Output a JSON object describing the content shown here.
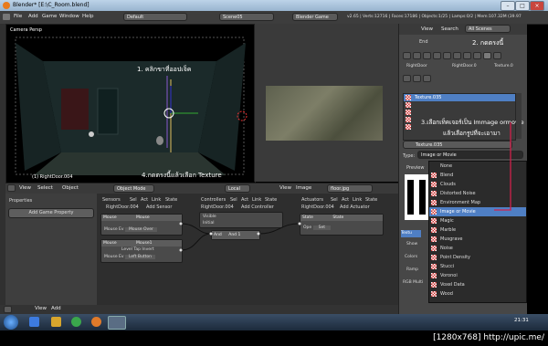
{
  "window": {
    "title": "Blender* [E:\\C_Room.blend]"
  },
  "menu": {
    "items": [
      "File",
      "Add",
      "Game",
      "Window",
      "Help"
    ],
    "layout": "Default",
    "scene": "Scene05",
    "engine": "Blender Game",
    "stats": "v2.65 | Verts:12716 | Faces:17186 | Objects:1/25 | Lamps:0/2 | Mem:107.32M (39.97"
  },
  "viewport": {
    "label": "Camera Persp",
    "object": "(1) RightDoor.004"
  },
  "annotations": {
    "a1": "1. คลิกขาที่ออปเจ็ค",
    "a2": "2. กดตรงนี้",
    "a3": "3.เลือกเท็คเจอร์เป็น Immage ormovie",
    "a3b": "แล้วเลือกรูปที่จะเอามา",
    "a4": "4.กดตรงนี้แล้วเลือก Texture"
  },
  "toolbar": {
    "items": [
      "View",
      "Select",
      "Object"
    ],
    "mode": "Object Mode",
    "orient": "Local",
    "view": "View",
    "image": "Image",
    "image_name": "floor.jpg"
  },
  "props": {
    "title": "Properties",
    "add_btn": "Add Game Property"
  },
  "logic": {
    "sensors": {
      "head": "Sensors",
      "sel": "Sel",
      "act": "Act",
      "link": "Link",
      "state": "State",
      "obj": "RightDoor.004",
      "add": "Add Sensor",
      "s1": "Mouse",
      "s1b": "Mouse",
      "s1ev": "Mouse Over",
      "s2": "Mouse",
      "s2b": "Mouse1",
      "s2ev": "Left Button",
      "level": "Level",
      "tap": "Tap",
      "invert": "Invert"
    },
    "controllers": {
      "head": "Controllers",
      "sel": "Sel",
      "act": "Act",
      "link": "Link",
      "state": "State",
      "obj": "RightDoor.004",
      "add": "Add Controller",
      "visible": "Visible",
      "initial": "Initial",
      "and": "And",
      "and_label": "And 1"
    },
    "actuators": {
      "head": "Actuators",
      "sel": "Sel",
      "act": "Act",
      "link": "Link",
      "state": "State",
      "obj": "RightDoor.004",
      "add": "Add Actuator",
      "a1": "State",
      "a1b": "State",
      "op": "Ope",
      "set": "Set"
    }
  },
  "right": {
    "view": "View",
    "search": "Search",
    "allscenes": "All Scenes",
    "end": "End",
    "breadcrumb": [
      "RightDoor",
      "RightDoor.0",
      "Texture.0"
    ],
    "tex_list": [
      "Texture.035"
    ],
    "tex_name": "Texture.035",
    "type_label": "Type:",
    "type_value": "Image or Movie",
    "preview_label": "Preview",
    "type_options": [
      "None",
      "Blend",
      "Clouds",
      "Distorted Noise",
      "Environment Map",
      "Image or Movie",
      "Magic",
      "Marble",
      "Musgrave",
      "Noise",
      "Point Density",
      "Stucci",
      "Voronoi",
      "Voxel Data",
      "Wood"
    ],
    "selected_option": "Image or Movie",
    "side_labels": [
      "Textu",
      "Show",
      "Colors",
      "Ramp",
      "RGB Multi"
    ]
  },
  "taskbar": {
    "time": "21:31"
  },
  "watermark": {
    "text": "[1280x768] http://upic.me/"
  },
  "colors": {
    "accent": "#4f7fc4",
    "annotation_line": "#d0204a"
  }
}
